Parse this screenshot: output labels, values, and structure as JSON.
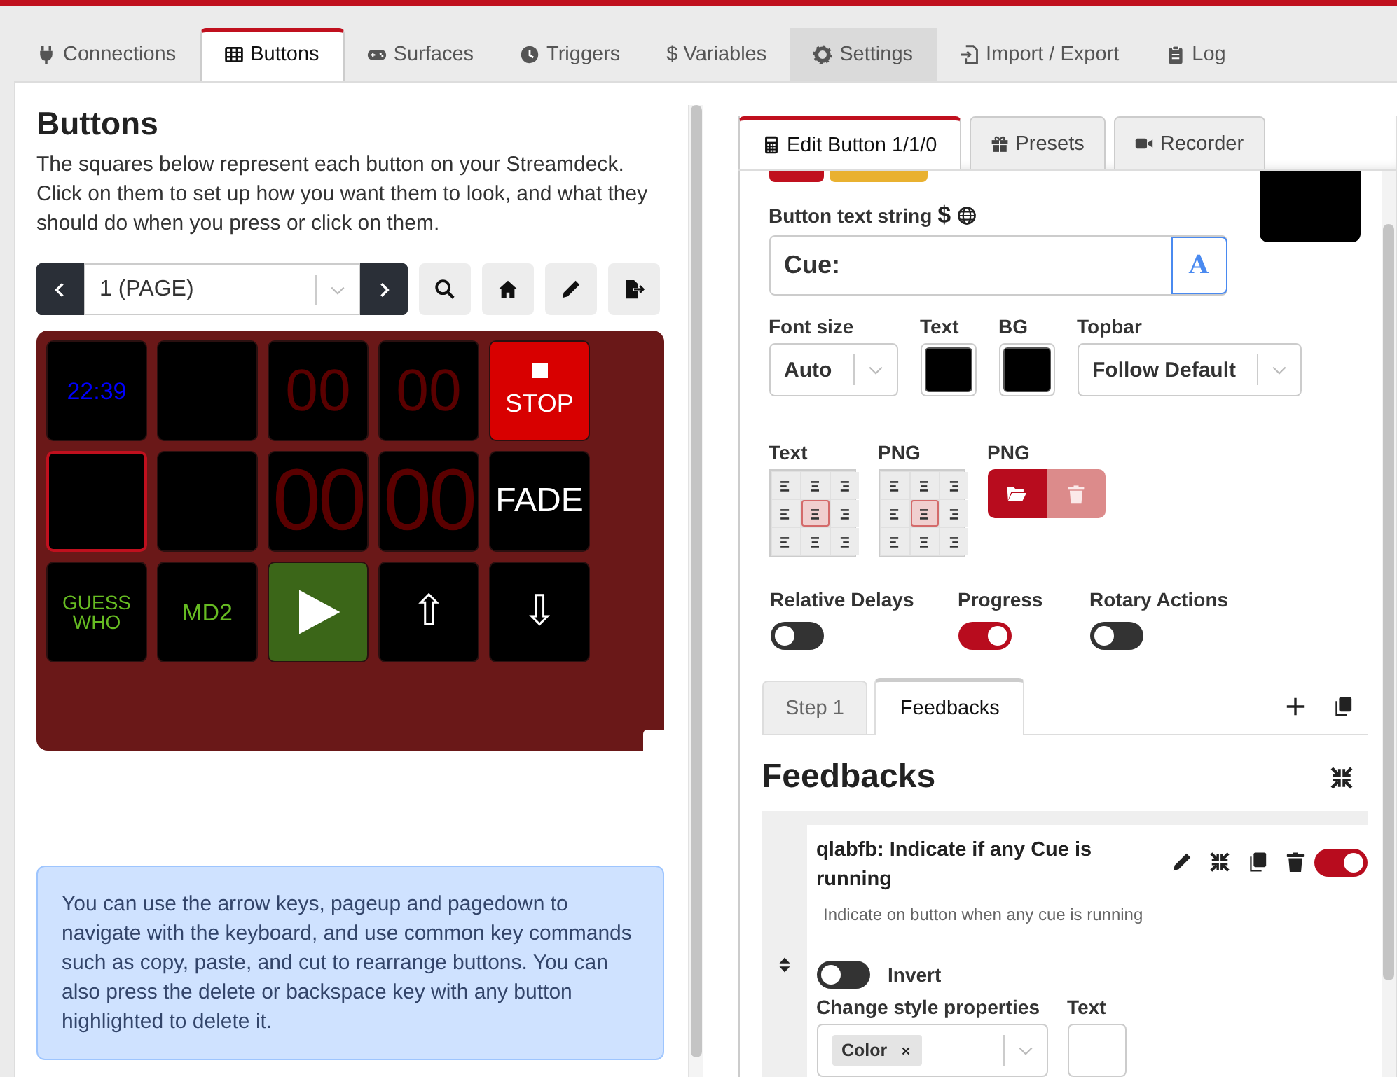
{
  "top_tabs": [
    {
      "label": "Connections",
      "selected": false,
      "highlighted": false
    },
    {
      "label": "Buttons",
      "selected": true,
      "highlighted": false
    },
    {
      "label": "Surfaces",
      "selected": false,
      "highlighted": false
    },
    {
      "label": "Triggers",
      "selected": false,
      "highlighted": false
    },
    {
      "label": "$ Variables",
      "selected": false,
      "highlighted": false
    },
    {
      "label": "Settings",
      "selected": false,
      "highlighted": true
    },
    {
      "label": "Import / Export",
      "selected": false,
      "highlighted": false
    },
    {
      "label": "Log",
      "selected": false,
      "highlighted": false
    }
  ],
  "buttons_panel": {
    "title": "Buttons",
    "description": "The squares below represent each button on your Streamdeck. Click on them to set up how you want them to look, and what they should do when you press or click on them.",
    "page": "1 (PAGE)",
    "grid": [
      {
        "kind": "small",
        "text": "22:39",
        "color": "#0000ff",
        "selected": false
      },
      {
        "kind": "blank",
        "selected": false
      },
      {
        "kind": "digits",
        "text": "00",
        "color": "#5a0000",
        "selected": false
      },
      {
        "kind": "digits",
        "text": "00",
        "color": "#5a0000",
        "selected": false
      },
      {
        "kind": "stop",
        "text": "STOP",
        "color": "#ffffff",
        "selected": false
      },
      {
        "kind": "blank",
        "selected": true
      },
      {
        "kind": "blank",
        "selected": false
      },
      {
        "kind": "bigdigits",
        "text": "00",
        "color": "#5a0000",
        "selected": false
      },
      {
        "kind": "bigdigits",
        "text": "00",
        "color": "#5a0000",
        "selected": false
      },
      {
        "kind": "caption",
        "text": "FADE",
        "color": "#ffffff",
        "selected": false
      },
      {
        "kind": "tiny",
        "text": "GUESS WHO",
        "color": "#66bb22",
        "selected": false
      },
      {
        "kind": "small",
        "text": "MD2",
        "color": "#66bb22",
        "selected": false
      },
      {
        "kind": "play",
        "selected": false
      },
      {
        "kind": "arrow",
        "text": "⇧",
        "color": "#ffffff",
        "selected": false
      },
      {
        "kind": "arrow",
        "text": "⇩",
        "color": "#ffffff",
        "selected": false
      }
    ],
    "tip": "You can use the arrow keys, pageup and pagedown to navigate with the keyboard, and use common key commands such as copy, paste, and cut to rearrange buttons. You can also press the delete or backspace key with any button highlighted to delete it."
  },
  "editor": {
    "tabs": [
      {
        "label": "Edit Button 1/1/0",
        "selected": true
      },
      {
        "label": "Presets",
        "selected": false
      },
      {
        "label": "Recorder",
        "selected": false
      }
    ],
    "swatches": [
      {
        "color": "#c0101e"
      },
      {
        "color": "#e9b130"
      }
    ],
    "text_label": "Button text string",
    "variable_glyph": "$",
    "text_value": "Cue:",
    "font_button": "A",
    "fields": [
      {
        "label": "Font size",
        "kind": "select",
        "value": "Auto"
      },
      {
        "label": "Text",
        "kind": "color",
        "color": "#000000"
      },
      {
        "label": "BG",
        "kind": "color",
        "color": "#000000"
      },
      {
        "label": "Topbar",
        "kind": "select",
        "value": "Follow Default"
      }
    ],
    "alignments": [
      {
        "label": "Text",
        "cells": [
          {
            "selected": false
          },
          {
            "selected": false
          },
          {
            "selected": false
          },
          {
            "selected": false
          },
          {
            "selected": true
          },
          {
            "selected": false
          },
          {
            "selected": false
          },
          {
            "selected": false
          },
          {
            "selected": false
          }
        ]
      },
      {
        "label": "PNG",
        "cells": [
          {
            "selected": false
          },
          {
            "selected": false
          },
          {
            "selected": false
          },
          {
            "selected": false
          },
          {
            "selected": true
          },
          {
            "selected": false
          },
          {
            "selected": false
          },
          {
            "selected": false
          },
          {
            "selected": false
          }
        ]
      }
    ],
    "png": {
      "label": "PNG",
      "clear_disabled": true
    },
    "toggles": [
      {
        "label": "Relative Delays",
        "on": false
      },
      {
        "label": "Progress",
        "on": true
      },
      {
        "label": "Rotary Actions",
        "on": false
      }
    ],
    "step_tabs": [
      {
        "label": "Step 1",
        "selected": false
      },
      {
        "label": "Feedbacks",
        "selected": true
      }
    ],
    "feedbacks": {
      "title": "Feedbacks",
      "items": [
        {
          "title": "qlabfb: Indicate if any Cue is running",
          "description": "Indicate on button when any cue is running",
          "enabled": true,
          "invert_label": "Invert",
          "invert": false,
          "style_label": "Change style properties",
          "style_tags": [
            "Color"
          ],
          "text_label": "Text"
        }
      ]
    }
  }
}
